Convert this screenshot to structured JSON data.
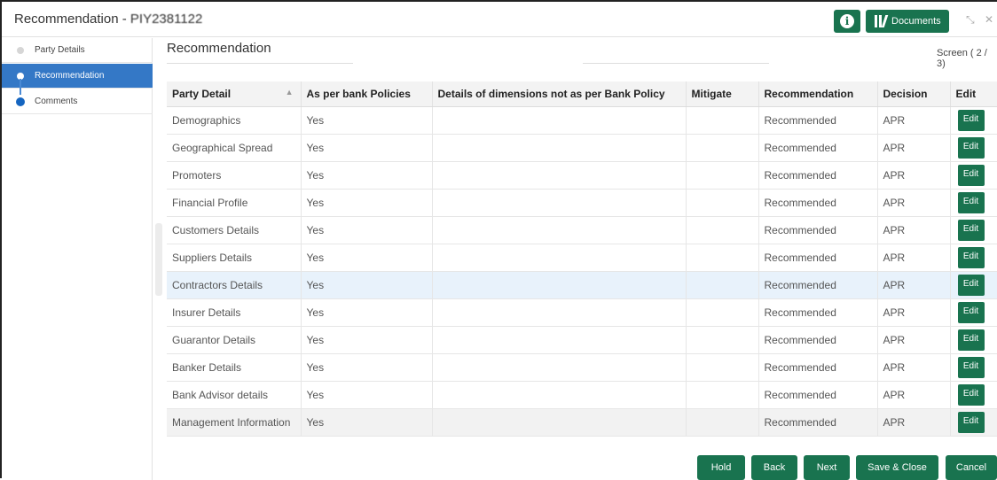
{
  "header": {
    "title_prefix": "Recommendation - ",
    "app_number": "PIY2381122",
    "docs_label": "Documents",
    "info_icon": "info-icon",
    "docs_icon": "library-icon",
    "minimize_glyph": "⤡",
    "close_glyph": "✕"
  },
  "sidebar": {
    "items": [
      {
        "label": "Party Details",
        "state": "done"
      },
      {
        "label": "Recommendation",
        "state": "active"
      },
      {
        "label": "Comments",
        "state": "current"
      }
    ]
  },
  "main": {
    "section_title": "Recommendation",
    "screen_indicator": "Screen ( 2 / 3)"
  },
  "table": {
    "headers": [
      "Party Detail",
      "As per bank Policies",
      "Details of dimensions not as per Bank Policy",
      "Mitigate",
      "Recommendation",
      "Decision",
      "Edit"
    ],
    "sort_glyph": "▲",
    "edit_label": "Edit",
    "rows": [
      {
        "party": "Demographics",
        "policy": "Yes",
        "details": "",
        "mitigate": "",
        "recommendation": "Recommended",
        "decision": "APR"
      },
      {
        "party": "Geographical Spread",
        "policy": "Yes",
        "details": "",
        "mitigate": "",
        "recommendation": "Recommended",
        "decision": "APR"
      },
      {
        "party": "Promoters",
        "policy": "Yes",
        "details": "",
        "mitigate": "",
        "recommendation": "Recommended",
        "decision": "APR"
      },
      {
        "party": "Financial Profile",
        "policy": "Yes",
        "details": "",
        "mitigate": "",
        "recommendation": "Recommended",
        "decision": "APR"
      },
      {
        "party": "Customers Details",
        "policy": "Yes",
        "details": "",
        "mitigate": "",
        "recommendation": "Recommended",
        "decision": "APR"
      },
      {
        "party": "Suppliers Details",
        "policy": "Yes",
        "details": "",
        "mitigate": "",
        "recommendation": "Recommended",
        "decision": "APR"
      },
      {
        "party": "Contractors Details",
        "policy": "Yes",
        "details": "",
        "mitigate": "",
        "recommendation": "Recommended",
        "decision": "APR"
      },
      {
        "party": "Insurer Details",
        "policy": "Yes",
        "details": "",
        "mitigate": "",
        "recommendation": "Recommended",
        "decision": "APR"
      },
      {
        "party": "Guarantor Details",
        "policy": "Yes",
        "details": "",
        "mitigate": "",
        "recommendation": "Recommended",
        "decision": "APR"
      },
      {
        "party": "Banker Details",
        "policy": "Yes",
        "details": "",
        "mitigate": "",
        "recommendation": "Recommended",
        "decision": "APR"
      },
      {
        "party": "Bank Advisor details",
        "policy": "Yes",
        "details": "",
        "mitigate": "",
        "recommendation": "Recommended",
        "decision": "APR"
      },
      {
        "party": "Management Information",
        "policy": "Yes",
        "details": "",
        "mitigate": "",
        "recommendation": "Recommended",
        "decision": "APR"
      }
    ]
  },
  "footer": {
    "hold": "Hold",
    "back": "Back",
    "next": "Next",
    "save_close": "Save & Close",
    "cancel": "Cancel"
  },
  "colors": {
    "brand_green": "#19734f",
    "active_blue": "#3478c6",
    "row_highlight": "#e8f2fb"
  }
}
